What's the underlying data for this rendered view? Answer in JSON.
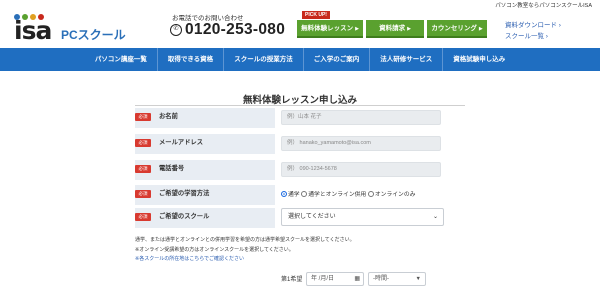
{
  "colors": {
    "accent_blue": "#1f6ec1",
    "cta_green": "#5aa12f",
    "required_red": "#d83a30",
    "pickup_red": "#c8291c"
  },
  "header": {
    "tagline": "パソコン教室ならパソコンスクールISA",
    "logo": {
      "main": "isa",
      "sub": "PCスクール"
    },
    "contact_caption": "お電話でのお問い合わせ",
    "phone_icon": "phone-icon",
    "phone_number": "0120-253-080",
    "pickup_label": "PICK UP!",
    "cta": [
      {
        "label": "無料体験レッスン"
      },
      {
        "label": "資料請求"
      },
      {
        "label": "カウンセリング"
      }
    ],
    "side_links": [
      "資料ダウンロード",
      "スクール一覧"
    ]
  },
  "nav": [
    "パソコン講座一覧",
    "取得できる資格",
    "スクールの授業方法",
    "ご入学のご案内",
    "法人研修サービス",
    "資格試験申し込み"
  ],
  "form": {
    "title": "無料体験レッスン申し込み",
    "required_badge": "必須",
    "name": {
      "label": "お名前",
      "placeholder": "例）山本 花子"
    },
    "email": {
      "label": "メールアドレス",
      "placeholder": "例） hanako_yamamoto@isa.com"
    },
    "phone": {
      "label": "電話番号",
      "placeholder": "例） 090-1234-5678"
    },
    "method": {
      "label": "ご希望の学習方法",
      "options": [
        "通学",
        "通学とオンライン併用",
        "オンラインのみ"
      ],
      "selected": "通学"
    },
    "school": {
      "label": "ご希望のスクール",
      "value": "選択してください"
    },
    "notes": [
      "通学、または通学とオンラインとの併用学習を希望の方は通学希望スクールを選択してください。",
      "※オンライン受講希望の方はオンラインスクールを選択してください。",
      "※各スクールの所在地はこちらでご確認ください"
    ],
    "preference": {
      "label": "第1希望",
      "date_value": "年 /月/日",
      "time_value": "-時間-"
    }
  }
}
